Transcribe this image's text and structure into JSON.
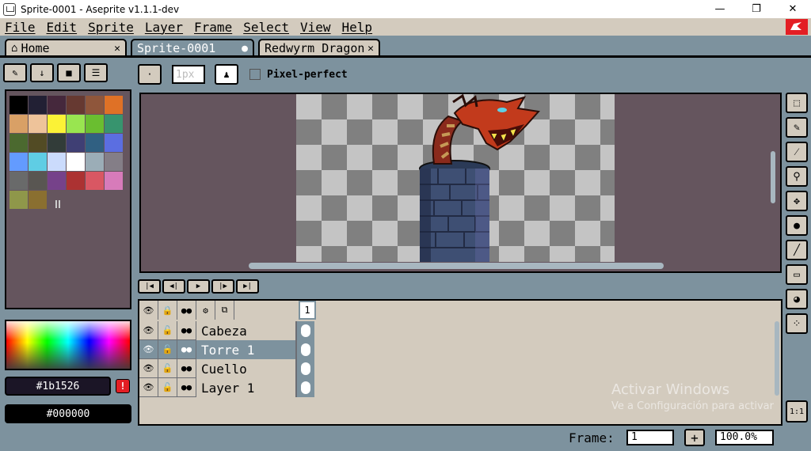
{
  "window": {
    "title": "Sprite-0001 - Aseprite v1.1.1-dev",
    "minimize": "—",
    "maximize": "❐",
    "close": "✕"
  },
  "menu": [
    "File",
    "Edit",
    "Sprite",
    "Layer",
    "Frame",
    "Select",
    "View",
    "Help"
  ],
  "tabs": [
    {
      "label": "Home",
      "close": "✕"
    },
    {
      "label": "Sprite-0001",
      "close": "●"
    },
    {
      "label": "Redwyrm Dragon",
      "close": "✕"
    }
  ],
  "palette_colors": [
    "#000000",
    "#222034",
    "#45283c",
    "#663931",
    "#8f563b",
    "#df7126",
    "#d9a066",
    "#eec39a",
    "#fbf236",
    "#99e550",
    "#6abe30",
    "#37946e",
    "#4b692f",
    "#524b24",
    "#323c39",
    "#3f3f74",
    "#306082",
    "#5b6ee1",
    "#639bff",
    "#5fcde4",
    "#cbdbfc",
    "#ffffff",
    "#9badb7",
    "#847e87",
    "#696a6a",
    "#595652",
    "#76428a",
    "#ac3232",
    "#d95763",
    "#d77bba",
    "#8f974a",
    "#8a6f30"
  ],
  "colors": {
    "foreground": "#1b1526",
    "background": "#000000",
    "warning_glyph": "!"
  },
  "brush": {
    "size_placeholder": "1px",
    "pixel_perfect_label": "Pixel-perfect"
  },
  "layers": [
    {
      "name": "Cabeza"
    },
    {
      "name": "Torre 1"
    },
    {
      "name": "Cuello"
    },
    {
      "name": "Layer 1"
    }
  ],
  "timeline": {
    "frame_header": "1"
  },
  "status": {
    "frame_label": "Frame:",
    "frame_value": "1",
    "add_frame": "+",
    "zoom_value": "100.0%"
  },
  "right_tools": [
    "marquee-icon",
    "pencil-icon",
    "eyedropper-icon",
    "zoom-icon",
    "move-icon",
    "fill-icon",
    "line-icon",
    "rectangle-icon",
    "blur-icon",
    "spray-icon"
  ],
  "zoom_reset_label": "1:1",
  "watermark": {
    "line1": "Activar Windows",
    "line2": "Ve a Configuración para activar"
  }
}
